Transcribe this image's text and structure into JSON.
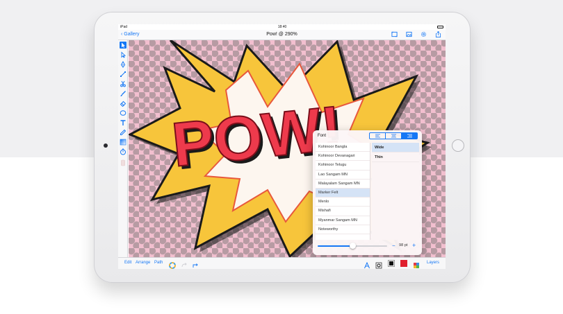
{
  "status_bar": {
    "carrier": "iPad",
    "time": "18:40"
  },
  "nav": {
    "back_label": "Gallery",
    "title": "Pow! @ 290%",
    "icons": [
      "fullscreen-icon",
      "image-icon",
      "settings-icon",
      "share-icon"
    ]
  },
  "tools": [
    "select-arrow-icon",
    "direct-select-icon",
    "pen-icon",
    "node-icon",
    "scissors-icon",
    "brush-icon",
    "eraser-icon",
    "ellipse-icon",
    "text-icon",
    "eyedropper-icon",
    "gradient-icon",
    "timer-icon",
    "color-swatch-icon"
  ],
  "canvas": {
    "word": "POW!",
    "colors": {
      "background": "#f2bfcf",
      "dots": "#b79ba3",
      "starburst": "#f7c53b",
      "inner": "#fdf6ef",
      "text": "#ee3a4c",
      "outline": "#1a1a1a"
    }
  },
  "popover": {
    "title": "Font",
    "alignment": [
      "align-left-icon",
      "align-center-icon",
      "align-right-icon"
    ],
    "fonts": [
      "Kohinoor Bangla",
      "Kohinoor Devanagari",
      "Kohinoor Telugu",
      "Lao Sangam MN",
      "Malayalam Sangam MN",
      "Marker Felt",
      "Menlo",
      "Mishafi",
      "Myanmar Sangam MN",
      "Noteworthy"
    ],
    "selected_font": "Marker Felt",
    "styles": [
      "Wide",
      "Thin"
    ],
    "selected_style": "Wide",
    "size_label": "98 pt",
    "size_fraction": 0.5,
    "minus": "−",
    "plus": "+"
  },
  "bottom": {
    "edit": "Edit",
    "arrange": "Arrange",
    "path": "Path",
    "layers": "Layers",
    "accent": "#1577f5",
    "stroke_color": "#111111",
    "fill_color": "#e0202e"
  }
}
